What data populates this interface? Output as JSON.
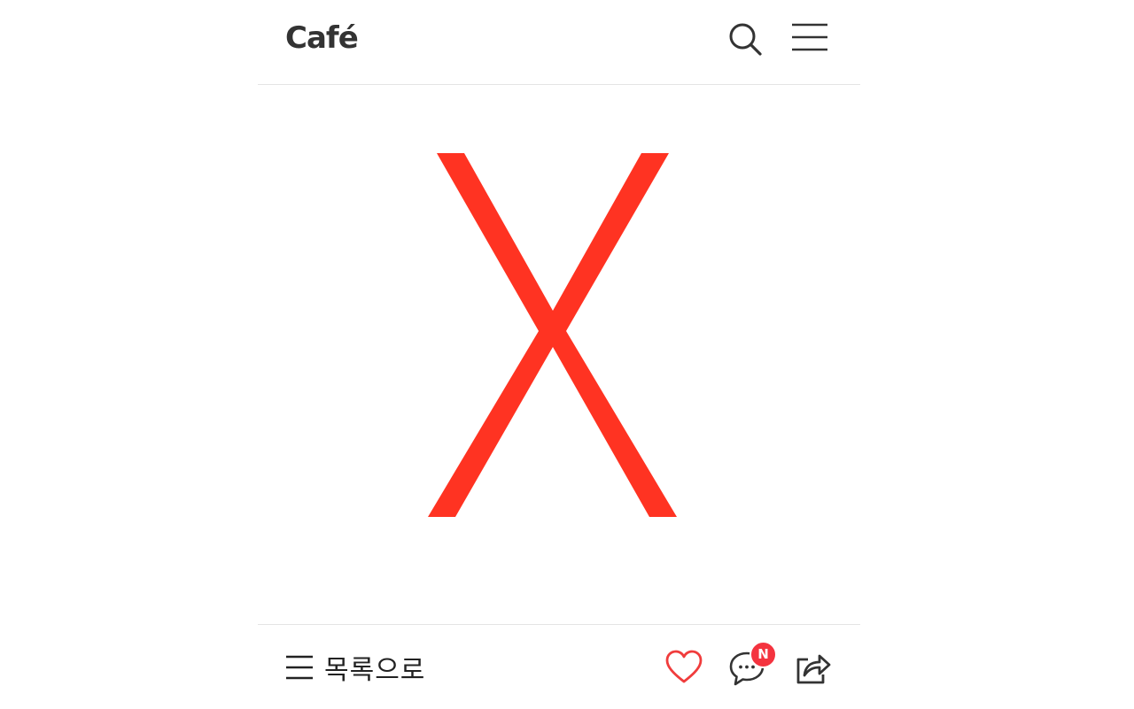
{
  "header": {
    "logo_text": "Café",
    "search_icon": "search-icon",
    "menu_icon": "hamburger-menu-icon"
  },
  "content": {
    "image_icon": "x-mark-icon",
    "mark_color": "#ff3322"
  },
  "footer": {
    "back_label": "목록으로",
    "back_icon": "list-icon",
    "like_icon": "heart-icon",
    "comment_icon": "comment-icon",
    "comment_badge": "N",
    "share_icon": "share-icon",
    "like_color": "#f03c3c",
    "badge_color": "#f4333f"
  }
}
